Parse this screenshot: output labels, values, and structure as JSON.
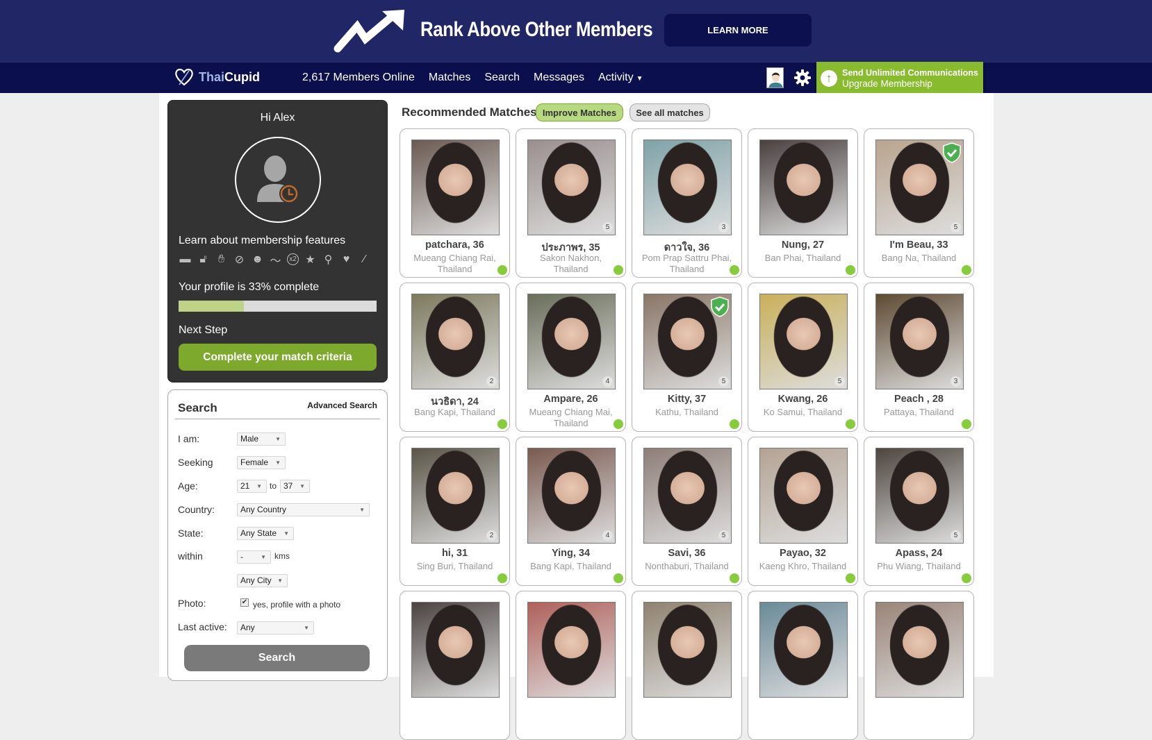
{
  "banner": {
    "headline": "Rank Above Other Members",
    "learn_more": "LEARN MORE",
    "icon": "trending-up-arrow-icon"
  },
  "nav": {
    "brand_prefix": "Thai",
    "brand_suffix": "Cupid",
    "members_online": "2,617 Members Online",
    "links": [
      "Matches",
      "Search",
      "Messages",
      "Activity"
    ],
    "upgrade": {
      "line1": "Send Unlimited Communications",
      "line2": "Upgrade Membership"
    }
  },
  "profile": {
    "greeting": "Hi Alex",
    "learn_features": "Learn about membership features",
    "feature_icons": [
      "chat-icon",
      "unlock-icon",
      "hand-icon",
      "hidden-eye-icon",
      "users-star-icon",
      "trend-icon",
      "x2-icon",
      "star-icon",
      "search-icon",
      "hearts-icon",
      "magic-wand-icon"
    ],
    "completion_text": "Your profile is 33% complete",
    "completion_percent": 33,
    "next_step_label": "Next Step",
    "cta": "Complete your match criteria"
  },
  "search": {
    "title": "Search",
    "advanced": "Advanced Search",
    "fields": {
      "i_am_label": "I am:",
      "i_am_value": "Male",
      "seeking_label": "Seeking",
      "seeking_value": "Female",
      "age_label": "Age:",
      "age_from": "21",
      "age_to_label": "to",
      "age_to": "37",
      "country_label": "Country:",
      "country_value": "Any Country",
      "state_label": "State:",
      "state_value": "Any State",
      "within_label": "within",
      "within_value": "-",
      "within_unit": "kms",
      "city_value": "Any City",
      "photo_label": "Photo:",
      "photo_checked": true,
      "photo_text": "yes, profile with a photo",
      "last_active_label": "Last active:",
      "last_active_value": "Any"
    },
    "button": "Search"
  },
  "matches": {
    "title": "Recommended Matches",
    "improve": "Improve Matches",
    "see_all": "See all matches",
    "cards": [
      {
        "name": "patchara, 36",
        "location": "Mueang Chiang Rai, Thailand",
        "photos": "",
        "verified": false,
        "color": "#6b5a52"
      },
      {
        "name": "ประภาพร, 35",
        "location": "Sakon Nakhon, Thailand",
        "photos": "5",
        "verified": false,
        "color": "#9a8f8f"
      },
      {
        "name": "ดาวใจ, 36",
        "location": "Pom Prap Sattru Phai, Thailand",
        "photos": "3",
        "verified": false,
        "color": "#7fa3a8"
      },
      {
        "name": "Nung, 27",
        "location": "Ban Phai, Thailand",
        "photos": "",
        "verified": false,
        "color": "#4a4040"
      },
      {
        "name": "I'm Beau, 33",
        "location": "Bang Na, Thailand",
        "photos": "5",
        "verified": true,
        "color": "#b9a48f"
      },
      {
        "name": "นวธิดา, 24",
        "location": "Bang Kapi, Thailand",
        "photos": "2",
        "verified": false,
        "color": "#7d7a5e"
      },
      {
        "name": "Ampare, 26",
        "location": "Mueang Chiang Mai, Thailand",
        "photos": "4",
        "verified": false,
        "color": "#6a6e5a"
      },
      {
        "name": "Kitty, 37",
        "location": "Kathu, Thailand",
        "photos": "5",
        "verified": true,
        "color": "#8a7668"
      },
      {
        "name": "Kwang, 26",
        "location": "Ko Samui, Thailand",
        "photos": "5",
        "verified": false,
        "color": "#c9b05a"
      },
      {
        "name": "Peach , 28",
        "location": "Pattaya, Thailand",
        "photos": "3",
        "verified": false,
        "color": "#5e4a32"
      },
      {
        "name": "hi, 31",
        "location": "Sing Buri, Thailand",
        "photos": "2",
        "verified": false,
        "color": "#5b5548"
      },
      {
        "name": "Ying, 34",
        "location": "Bang Kapi, Thailand",
        "photos": "4",
        "verified": false,
        "color": "#7a5a50"
      },
      {
        "name": "Savi, 36",
        "location": "Nonthaburi, Thailand",
        "photos": "5",
        "verified": false,
        "color": "#8e7e78"
      },
      {
        "name": "Payao, 32",
        "location": "Kaeng Khro, Thailand",
        "photos": "",
        "verified": false,
        "color": "#b4a394"
      },
      {
        "name": "Apass, 24",
        "location": "Phu Wiang, Thailand",
        "photos": "5",
        "verified": false,
        "color": "#4e4640"
      },
      {
        "name": "",
        "location": "",
        "photos": "",
        "verified": false,
        "color": "#4b4341"
      },
      {
        "name": "",
        "location": "",
        "photos": "",
        "verified": false,
        "color": "#b0605a"
      },
      {
        "name": "",
        "location": "",
        "photos": "",
        "verified": false,
        "color": "#8f8270"
      },
      {
        "name": "",
        "location": "",
        "photos": "",
        "verified": false,
        "color": "#6a8a99"
      },
      {
        "name": "",
        "location": "",
        "photos": "",
        "verified": false,
        "color": "#9a8478"
      }
    ]
  },
  "colors": {
    "banner_bg": "#212766",
    "nav_bg": "#0b0f4d",
    "accent_green": "#7daa2d",
    "online_dot": "#86cc3c"
  }
}
